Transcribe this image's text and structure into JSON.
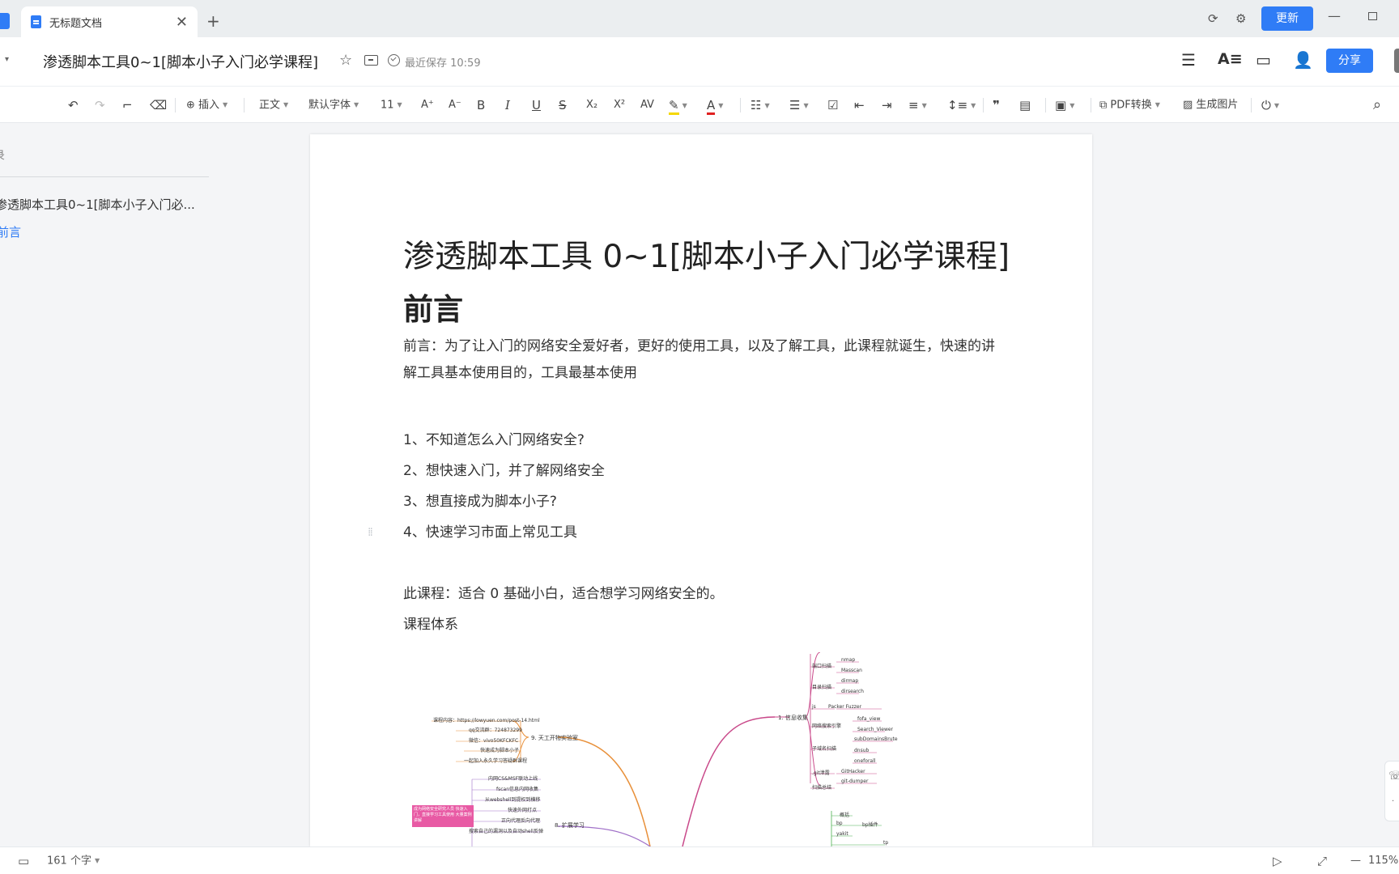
{
  "tab": {
    "title": "无标题文档",
    "close": "✕",
    "new": "+"
  },
  "window": {
    "update_label": "更新",
    "minimize": "—"
  },
  "titlebar": {
    "doc_title": "渗透脚本工具0~1[脚本小子入门必学课程]",
    "star": "☆",
    "saved_status": "最近保存 10:59",
    "share_label": "分享"
  },
  "toolbar": {
    "undo": "↶",
    "redo": "↷",
    "insert": "插入",
    "style": "正文",
    "font": "默认字体",
    "font_size": "11",
    "grow": "A⁺",
    "shrink": "A⁻",
    "bold": "B",
    "italic": "I",
    "underline": "U",
    "strike": "S",
    "subscript": "X₂",
    "superscript": "X²",
    "spacing": "AV",
    "font_color": "A",
    "pdf_convert": "PDF转换",
    "gen_image": "生成图片",
    "search": "⌕"
  },
  "outline": {
    "header": "录",
    "items": [
      "渗透脚本工具0~1[脚本小子入门必...",
      "前言"
    ]
  },
  "document": {
    "title": "渗透脚本工具 0~1[脚本小子入门必学课程]",
    "heading": "前言",
    "intro": "前言：为了让入门的网络安全爱好者，更好的使用工具，以及了解工具，此课程就诞生，快速的讲解工具基本使用目的，工具最基本使用",
    "list": [
      "1、不知道怎么入门网络安全?",
      "2、想快速入门，并了解网络安全",
      "3、想直接成为脚本小子?",
      "4、快速学习市面上常见工具"
    ],
    "suitable": "此课程：适合 0 基础小白，适合想学习网络安全的。",
    "system": "课程体系"
  },
  "mindmap": {
    "right_root": "1. 信息收集",
    "right_groups": [
      "端口扫描",
      "目录扫描",
      "js",
      "网络搜索引擎",
      "子域名扫描",
      ".git泄露",
      "扫描总结"
    ],
    "right_leaves": [
      "nmap",
      "Masscan",
      "dirmap",
      "dirsearch",
      "Packer Fuzzer",
      "fofa_view",
      "Search_Viewer",
      "subDomainsBrute",
      "dnsub",
      "oneforall",
      "GitHacker",
      "git-dumper"
    ],
    "left_root": "9. 天工开物实验室",
    "left_leaves": [
      "课程内容：https://lowyuen.com/post-14.html",
      "qq交流群：724873299",
      "微信：vivo50KFCKFC",
      "快速成为脚本小子",
      "一起加入永久学习答疑群课程"
    ],
    "left_root2": "8. 扩展学习",
    "left_leaves2": [
      "内网CS&MSF联动上线",
      "fscan信息内网收集",
      "从webshell到提权到横移",
      "快速外网打点",
      "正向代理反向代理",
      "搜索自己的漏洞以及自动shell反弹"
    ],
    "pink_note": "成为网络安全研究人员 快速入门，直接学习工具使用 大量案例讲解",
    "bottom_labels": [
      "概括",
      "bp",
      "bp插件",
      "yakit",
      "tp"
    ]
  },
  "statusbar": {
    "word_count": "161 个字",
    "zoom": "115%",
    "zoom_out": "—"
  },
  "colors": {
    "accent": "#2f7cf6",
    "mm_pink": "#c9498a",
    "mm_orange": "#e8903a",
    "mm_green": "#4caf50"
  }
}
